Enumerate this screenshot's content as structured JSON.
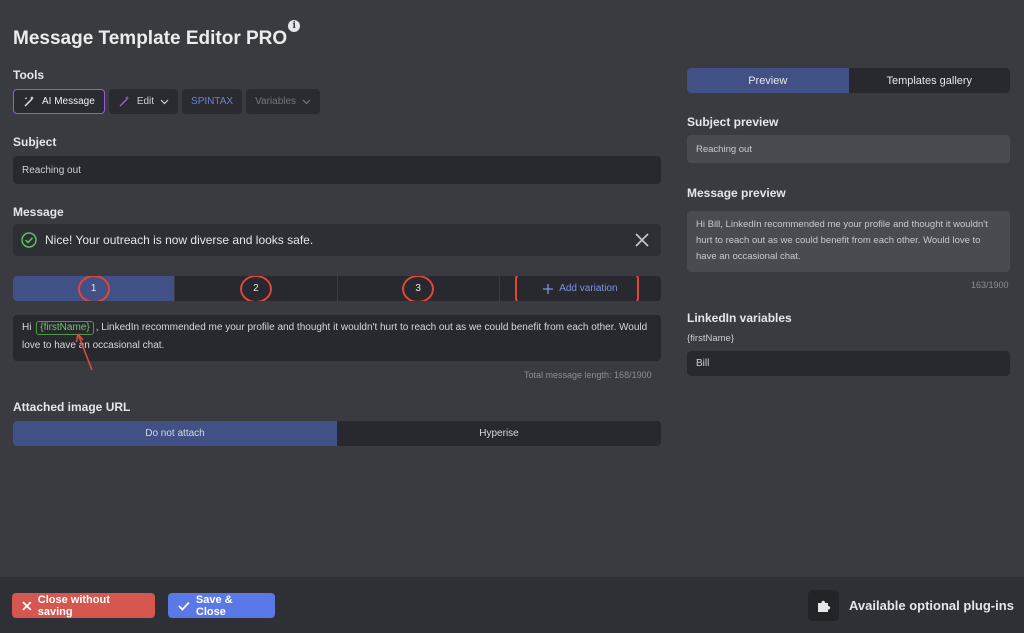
{
  "header": {
    "title": "Message Template Editor PRO",
    "info_glyph": "i"
  },
  "tools": {
    "label": "Tools",
    "ai_message": "AI Message",
    "edit": "Edit",
    "spintax": "SPINTAX",
    "variables": "Variables"
  },
  "subject": {
    "label": "Subject",
    "value": "Reaching out"
  },
  "message": {
    "label": "Message",
    "alert": "Nice! Your outreach is now diverse and looks safe.",
    "variations": [
      "1",
      "2",
      "3"
    ],
    "add_variation": "Add variation",
    "text_prefix": "Hi",
    "variable_chip": "{firstName}",
    "text_suffix": ", LinkedIn recommended me your profile and thought it wouldn't hurt to reach out as we could benefit from each other. Would love to have an occasional chat.",
    "total_length": "Total message length: 168/1900"
  },
  "attachment": {
    "label": "Attached image URL",
    "options": [
      "Do not attach",
      "Hyperise"
    ]
  },
  "right_panel": {
    "tabs": [
      "Preview",
      "Templates gallery"
    ],
    "subject_preview_label": "Subject preview",
    "subject_preview_value": "Reaching out",
    "message_preview_label": "Message preview",
    "message_preview_value": "Hi Bill, LinkedIn recommended me your profile and thought it wouldn't hurt to reach out as we could benefit from each other. Would love to have an occasional chat.",
    "message_preview_count": "163/1900",
    "variables_label": "LinkedIn variables",
    "variable_name": "{firstName}",
    "variable_value": "Bill"
  },
  "footer": {
    "close_label": "Close without saving",
    "save_label": "Save & Close",
    "plugins_label": "Available optional plug-ins"
  },
  "colors": {
    "background": "#3a3b41",
    "active_tab": "#415185",
    "close_button": "#d5574f",
    "save_button": "#5b79e6",
    "ai_border": "#9b59d9",
    "annotation": "#e0463a"
  }
}
